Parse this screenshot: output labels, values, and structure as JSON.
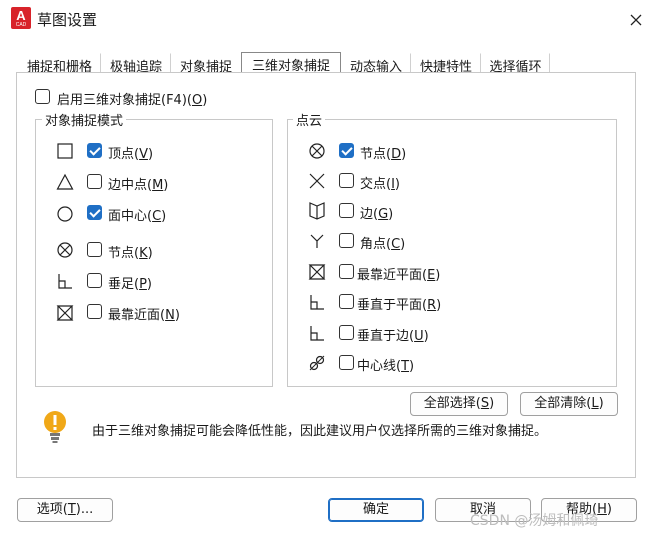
{
  "window": {
    "title": "草图设置",
    "icon_letter": "A",
    "icon_sub": "CAD"
  },
  "tabs": [
    {
      "label": "捕捉和栅格"
    },
    {
      "label": "极轴追踪"
    },
    {
      "label": "对象捕捉"
    },
    {
      "label": "三维对象捕捉",
      "active": true
    },
    {
      "label": "动态输入"
    },
    {
      "label": "快捷特性"
    },
    {
      "label": "选择循环"
    }
  ],
  "enable": {
    "label": "启用三维对象捕捉(F4)(",
    "key": "O",
    "close": ")",
    "checked": false
  },
  "object_snap_modes": {
    "title": "对象捕捉模式",
    "items": [
      {
        "symbol": "vertex-square-icon",
        "text": "顶点(",
        "key": "V",
        "checked": true
      },
      {
        "symbol": "edge-midpoint-triangle-icon",
        "text": "边中点(",
        "key": "M",
        "checked": false
      },
      {
        "symbol": "face-center-circle-icon",
        "text": "面中心(",
        "key": "C",
        "checked": true
      },
      {
        "symbol": "node-circle-x-icon",
        "text": "节点(",
        "key": "K",
        "checked": false
      },
      {
        "symbol": "perpendicular-icon",
        "text": "垂足(",
        "key": "P",
        "checked": false
      },
      {
        "symbol": "nearest-face-hourglass-icon",
        "text": "最靠近面(",
        "key": "N",
        "checked": false
      }
    ]
  },
  "point_cloud": {
    "title": "点云",
    "items": [
      {
        "symbol": "node-circle-x-icon",
        "text": "节点(",
        "key": "D",
        "checked": true
      },
      {
        "symbol": "intersection-x-icon",
        "text": "交点(",
        "key": "I",
        "checked": false
      },
      {
        "symbol": "edge-book-icon",
        "text": "边(",
        "key": "G",
        "checked": false
      },
      {
        "symbol": "corner-y-icon",
        "text": "角点(",
        "key": "C",
        "checked": false
      },
      {
        "symbol": "nearest-plane-hourglass-icon",
        "text": "最靠近平面(",
        "key": "E",
        "checked": false
      },
      {
        "symbol": "perpendicular-plane-icon",
        "text": "垂直于平面(",
        "key": "R",
        "checked": false
      },
      {
        "symbol": "perpendicular-edge-icon",
        "text": "垂直于边(",
        "key": "U",
        "checked": false
      },
      {
        "symbol": "centerline-link-icon",
        "text": "中心线(",
        "key": "T",
        "checked": false
      }
    ]
  },
  "buttons": {
    "select_all": {
      "text": "全部选择(",
      "key": "S"
    },
    "clear_all": {
      "text": "全部清除(",
      "key": "L"
    },
    "options": {
      "text": "选项(",
      "key": "T",
      "suffix": ")..."
    },
    "ok": "确定",
    "cancel": "取消",
    "help": {
      "text": "帮助(",
      "key": "H"
    }
  },
  "info": {
    "icon": "bulb-warning-icon",
    "text": "由于三维对象捕捉可能会降低性能，因此建议用户仅选择所需的三维对象捕捉。"
  },
  "watermark": "CSDN @汤姆和佩琦"
}
